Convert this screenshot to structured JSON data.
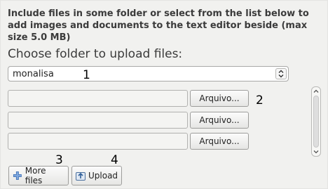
{
  "instructions": "Include files in some folder or select from the list below to add images and documents to the text editor beside (max size 5.0 MB)",
  "folder_heading": "Choose folder to upload files:",
  "folder_select": {
    "value": "monalisa",
    "icon": "updown-arrows-icon"
  },
  "callouts": {
    "one": "1",
    "two": "2",
    "three": "3",
    "four": "4"
  },
  "file_rows": [
    {
      "value": "",
      "button_label": "Arquivo..."
    },
    {
      "value": "",
      "button_label": "Arquivo..."
    },
    {
      "value": "",
      "button_label": "Arquivo..."
    }
  ],
  "actions": {
    "more_files": {
      "label": "More files",
      "icon": "plus-icon"
    },
    "upload": {
      "label": "Upload",
      "icon": "upload-icon"
    }
  },
  "colors": {
    "background": "#f1f1ef",
    "text": "#3b3b3b",
    "plus_icon": "#3a6fb5"
  }
}
